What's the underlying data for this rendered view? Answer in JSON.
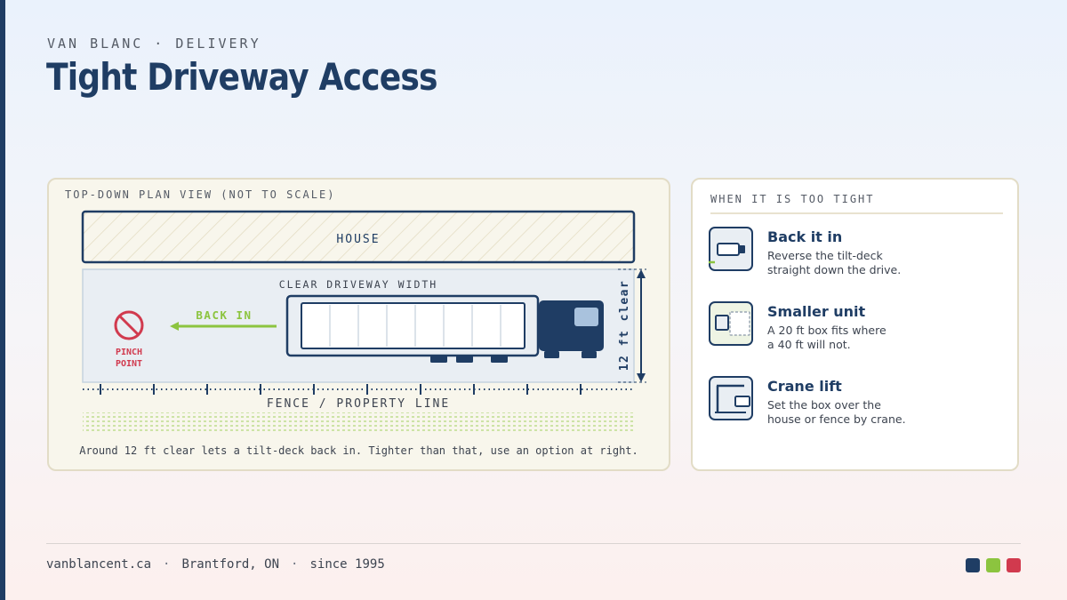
{
  "header": {
    "eyebrow": "VAN BLANC · DELIVERY",
    "title": "Tight Driveway Access"
  },
  "plan": {
    "label": "TOP-DOWN PLAN VIEW (NOT TO SCALE)",
    "house_label": "HOUSE",
    "driveway_label": "CLEAR DRIVEWAY WIDTH",
    "back_in_label": "BACK IN",
    "pinch_label_1": "PINCH",
    "pinch_label_2": "POINT",
    "clearance_label": "12 ft clear",
    "fence_label": "FENCE / PROPERTY LINE",
    "caption": "Around 12 ft clear lets a tilt-deck back in. Tighter than that, use an option at right."
  },
  "options": {
    "heading": "WHEN IT IS TOO TIGHT",
    "items": [
      {
        "icon": "truck-reverse-icon",
        "title": "Back it in",
        "desc_line1": "Reverse the tilt-deck",
        "desc_line2": "straight down the drive."
      },
      {
        "icon": "small-box-icon",
        "title": "Smaller unit",
        "desc_line1": "A 20 ft box fits where",
        "desc_line2": "a 40 ft will not."
      },
      {
        "icon": "crane-icon",
        "title": "Crane lift",
        "desc_line1": "Set the box over the",
        "desc_line2": "house or fence by crane."
      }
    ]
  },
  "footer": {
    "website": "vanblancent.ca",
    "separator": "·",
    "location": "Brantford, ON",
    "since": "since 1995"
  },
  "colors": {
    "navy": "#1f3d64",
    "green": "#8cc43f",
    "red": "#d13a4e",
    "cream": "#f8f6ec"
  }
}
